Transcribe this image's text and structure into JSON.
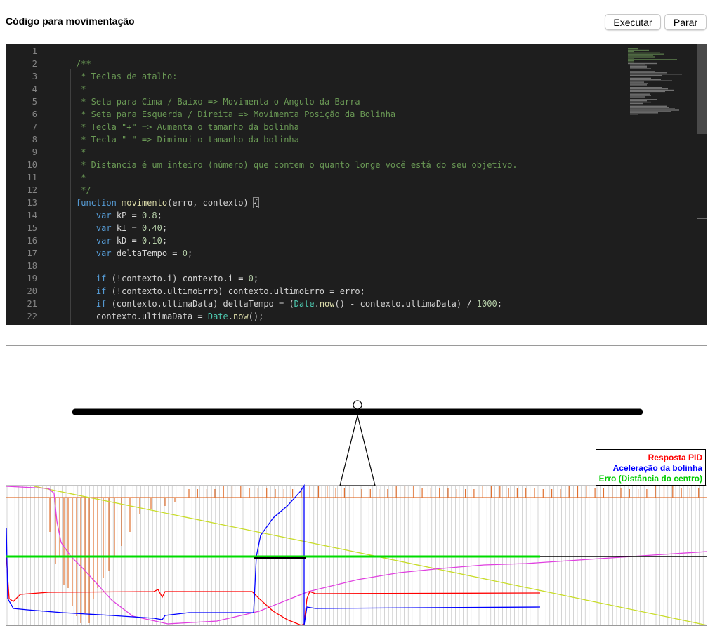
{
  "header": {
    "title": "Código para movimentação",
    "run_label": "Executar",
    "stop_label": "Parar"
  },
  "editor": {
    "line_numbers": [
      "1",
      "2",
      "3",
      "4",
      "5",
      "6",
      "7",
      "8",
      "9",
      "10",
      "11",
      "12",
      "13",
      "14",
      "15",
      "16",
      "17",
      "18",
      "19",
      "20",
      "21",
      "22"
    ],
    "lines": [
      [],
      [
        [
          "comment",
          "/**"
        ]
      ],
      [
        [
          "comment",
          " * Teclas de atalho:"
        ]
      ],
      [
        [
          "comment",
          " *"
        ]
      ],
      [
        [
          "comment",
          " * Seta para Cima / Baixo => Movimenta o Angulo da Barra"
        ]
      ],
      [
        [
          "comment",
          " * Seta para Esquerda / Direita => Movimenta Posição da Bolinha"
        ]
      ],
      [
        [
          "comment",
          " * Tecla \"+\" => Aumenta o tamanho da bolinha"
        ]
      ],
      [
        [
          "comment",
          " * Tecla \"-\" => Diminui o tamanho da bolinha"
        ]
      ],
      [
        [
          "comment",
          " *"
        ]
      ],
      [
        [
          "comment",
          " * Distancia é um inteiro (número) que contem o quanto longe você está do seu objetivo."
        ]
      ],
      [
        [
          "comment",
          " *"
        ]
      ],
      [
        [
          "comment",
          " */"
        ]
      ],
      [
        [
          "keyword",
          "function"
        ],
        [
          "var",
          " "
        ],
        [
          "fn",
          "movimento"
        ],
        [
          "punct",
          "(erro, contexto) "
        ],
        [
          "bracket",
          "{"
        ]
      ],
      [
        [
          "var",
          "    "
        ],
        [
          "keyword",
          "var"
        ],
        [
          "var",
          " kP = "
        ],
        [
          "num",
          "0.8"
        ],
        [
          "punct",
          ";"
        ]
      ],
      [
        [
          "var",
          "    "
        ],
        [
          "keyword",
          "var"
        ],
        [
          "var",
          " kI = "
        ],
        [
          "num",
          "0.40"
        ],
        [
          "punct",
          ";"
        ]
      ],
      [
        [
          "var",
          "    "
        ],
        [
          "keyword",
          "var"
        ],
        [
          "var",
          " kD = "
        ],
        [
          "num",
          "0.10"
        ],
        [
          "punct",
          ";"
        ]
      ],
      [
        [
          "var",
          "    "
        ],
        [
          "keyword",
          "var"
        ],
        [
          "var",
          " deltaTempo = "
        ],
        [
          "num",
          "0"
        ],
        [
          "punct",
          ";"
        ]
      ],
      [],
      [
        [
          "var",
          "    "
        ],
        [
          "keyword",
          "if"
        ],
        [
          "var",
          " (!contexto.i) contexto.i = "
        ],
        [
          "num",
          "0"
        ],
        [
          "punct",
          ";"
        ]
      ],
      [
        [
          "var",
          "    "
        ],
        [
          "keyword",
          "if"
        ],
        [
          "var",
          " (!contexto.ultimoErro) contexto.ultimoErro = erro;"
        ]
      ],
      [
        [
          "var",
          "    "
        ],
        [
          "keyword",
          "if"
        ],
        [
          "var",
          " (contexto.ultimaData) deltaTempo = ("
        ],
        [
          "type",
          "Date"
        ],
        [
          "punct",
          "."
        ],
        [
          "fn",
          "now"
        ],
        [
          "var",
          "() - contexto.ultimaData) / "
        ],
        [
          "num",
          "1000"
        ],
        [
          "punct",
          ";"
        ]
      ],
      [
        [
          "var",
          "    contexto.ultimaData = "
        ],
        [
          "type",
          "Date"
        ],
        [
          "punct",
          "."
        ],
        [
          "fn",
          "now"
        ],
        [
          "punct",
          "();"
        ]
      ]
    ]
  },
  "legend": {
    "pid_label": "Resposta PID",
    "accel_label": "Aceleração da bolinha",
    "error_label": "Erro (Distância do centro)",
    "pid_color": "#ff0000",
    "accel_color": "#0000ff",
    "error_color": "#00cc00"
  },
  "colors": {
    "editor_bg": "#1e1e1e",
    "comment": "#6a9955",
    "keyword": "#569cd6",
    "function": "#dcdcaa",
    "number": "#b5cea8",
    "type": "#4ec9b0",
    "line_number": "#858585"
  }
}
